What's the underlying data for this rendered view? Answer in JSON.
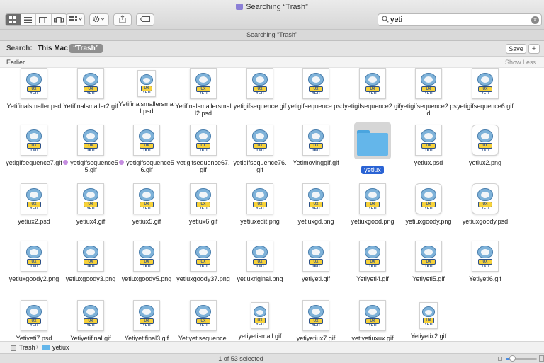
{
  "window": {
    "title": "Searching “Trash”",
    "tab_title": "Searching “Trash”"
  },
  "toolbar": {
    "view_icons": [
      "icon-view-icon",
      "list-view-icon",
      "column-view-icon",
      "cover-flow-icon"
    ],
    "arrange_icon": "arrange-icon",
    "action_icon": "gear-icon",
    "share_icon": "share-icon",
    "tag_icon": "tag-icon"
  },
  "search": {
    "value": "yeti",
    "placeholder": "Search"
  },
  "scope": {
    "label": "Search:",
    "this_mac": "This Mac",
    "trash": "“Trash”",
    "save": "Save",
    "add": "+"
  },
  "section": {
    "title": "Earlier",
    "toggle": "Show Less"
  },
  "files": [
    "Yetifinalsmaller.psd",
    "Yetifinalsmaller2.gif",
    "Yetifinalsmallersmall.psd",
    "Yetifinalsmallersmall2.psd",
    "yetigifsequence.gif",
    "yetigifsequence.psd",
    "yetigifsequence2.gif",
    "yetigifsequence2.psd",
    "yetigifsequence6.gif",
    "yetigifsequence7.gif",
    "yetigifsequence55.gif",
    "yetigifsequence56.gif",
    "yetigifsequence67.gif",
    "yetigifsequence76.gif",
    "Yetimovinggif.gif",
    "yetiux",
    "yetiux.psd",
    "yetiux2.png",
    "yetiux2.psd",
    "yetiux4.gif",
    "yetiux5.gif",
    "yetiux6.gif",
    "yetiuxedit.png",
    "yetiuxgd.png",
    "yetiuxgood.png",
    "yetiuxgoody.png",
    "yetiuxgoody.psd",
    "yetiuxgoody2.png",
    "yetiuxgoody3.png",
    "yetiuxgoody5.png",
    "yetiuxgoody37.png",
    "yetiuxriginal.png",
    "yetiyeti.gif",
    "Yetiyeti4.gif",
    "Yetiyeti5.gif",
    "Yetiyeti6.gif",
    "Yetiyeti7.psd",
    "Yetiyetifinal.gif",
    "Yetiyetifinal3.gif",
    "Yetiyetisequence.",
    "yetiyetismall.gif",
    "yetiyetiux7.gif",
    "yetiyetiuxux.gif",
    "Yetiyetix2.gif"
  ],
  "file_labels": [
    "Yetifinalsmaller.psd",
    "Yetifinalsmaller2.gif",
    "Yetifinalsmallersmall.psd",
    "Yetifinalsmallersmall2.psd",
    "yetigifsequence.gif",
    "yetigifsequence.psd",
    "yetigifsequence2.gif",
    "yetigifsequence2.psd",
    "yetigifsequence6.gif",
    "yetigifsequence7.gif",
    "yetigifsequence55.gif",
    "yetigifsequence56.gif",
    "yetigifsequence67.gif",
    "yetigifsequence76.gif",
    "Yetimovinggif.gif",
    "yetiux",
    "yetiux.psd",
    "yetiux2.png",
    "yetiux2.psd",
    "yetiux4.gif",
    "yetiux5.gif",
    "yetiux6.gif",
    "yetiuxedit.png",
    "yetiuxgd.png",
    "yetiuxgood.png",
    "yetiuxgoody.png",
    "yetiuxgoody.psd",
    "yetiuxgoody2.png",
    "yetiuxgoody3.png",
    "yetiuxgoody5.png",
    "yetiuxgoody37.png",
    "yetiuxriginal.png",
    "yetiyeti.gif",
    "Yetiyeti4.gif",
    "Yetiyeti5.gif",
    "Yetiyeti6.gif",
    "Yetiyeti7.psd",
    "Yetiyetifinal.gif",
    "Yetiyetifinal3.gif",
    "Yetiyetisequence.",
    "yetiyetismall.gif",
    "yetiyetiux7.gif",
    "yetiyetiuxux.gif",
    "Yetiyetix2.gif"
  ],
  "selected_item": "yetiux",
  "tagged_items": [
    "yetigifsequence55.gif",
    "yetigifsequence56.gif"
  ],
  "tag_color": "#c58de0",
  "path": {
    "root": "Trash",
    "folder": "yetiux"
  },
  "status": {
    "text": "1 of 53 selected"
  },
  "accent_color": "#2a63d4",
  "folder_color": "#64b6ea",
  "thumbnail_badge_text": "UX YETI"
}
